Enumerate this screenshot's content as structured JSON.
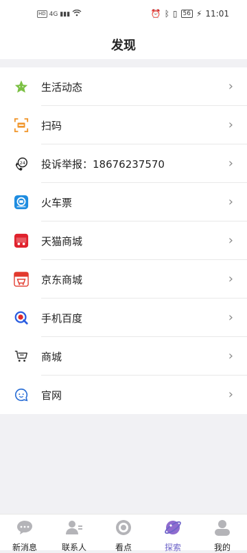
{
  "status_bar": {
    "left": [
      "HD",
      "4G",
      "▮▮▮",
      "Wi‑Fi"
    ],
    "battery": "56",
    "time": "11:01"
  },
  "header": {
    "title": "发现"
  },
  "items": [
    {
      "label": "生活动态",
      "icon": "green-star-icon"
    },
    {
      "label": "扫码",
      "icon": "scan-icon"
    },
    {
      "label": "投诉举报：18676237570",
      "icon": "phone-24-icon"
    },
    {
      "label": "火车票",
      "icon": "train-ticket-icon"
    },
    {
      "label": "天猫商城",
      "icon": "tmall-icon"
    },
    {
      "label": "京东商城",
      "icon": "jd-icon"
    },
    {
      "label": "手机百度",
      "icon": "baidu-icon"
    },
    {
      "label": "商城",
      "icon": "cart-icon"
    },
    {
      "label": "官网",
      "icon": "chat-face-icon"
    }
  ],
  "tabs": [
    {
      "label": "新消息",
      "icon": "message-icon"
    },
    {
      "label": "联系人",
      "icon": "contacts-icon"
    },
    {
      "label": "看点",
      "icon": "eye-icon"
    },
    {
      "label": "探索",
      "icon": "planet-icon",
      "active": true
    },
    {
      "label": "我的",
      "icon": "profile-icon"
    }
  ],
  "colors": {
    "accent": "#6d64c9",
    "background": "#f1f1f4"
  }
}
